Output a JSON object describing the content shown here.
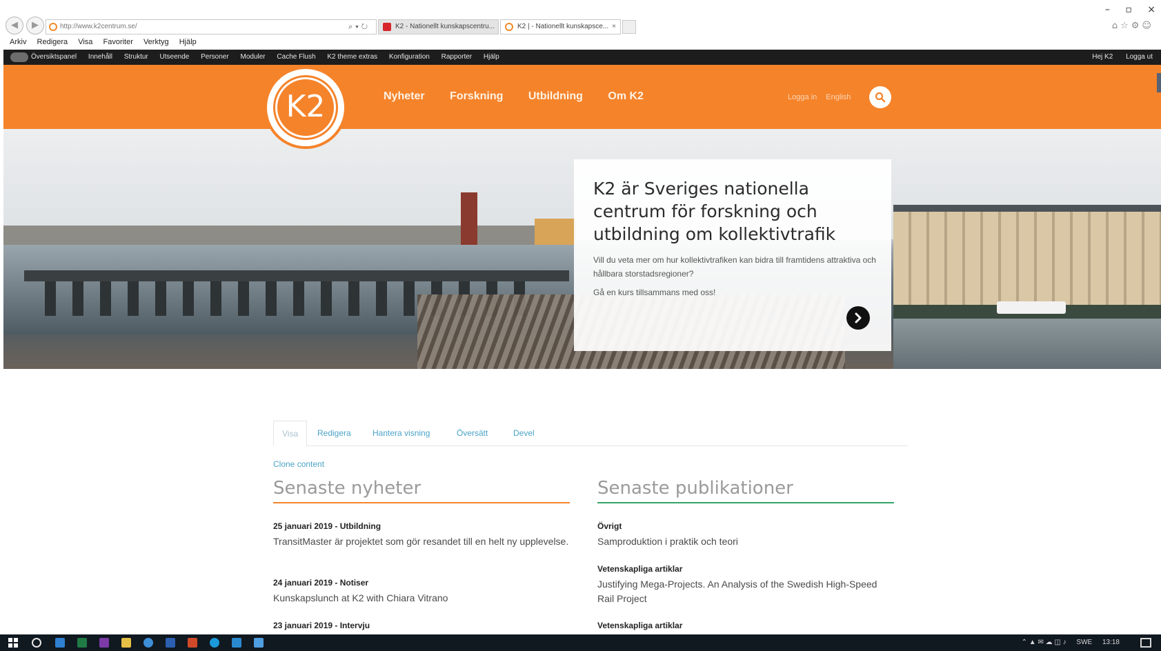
{
  "browser": {
    "address": "http://www.k2centrum.se/",
    "tabs": [
      {
        "label": "K2 - Nationellt kunskapscentru..."
      },
      {
        "label": "K2 | - Nationellt kunskapsce...",
        "close": "×"
      }
    ],
    "window_controls": "– ▫ ×",
    "menu": [
      "Arkiv",
      "Redigera",
      "Visa",
      "Favoriter",
      "Verktyg",
      "Hjälp"
    ]
  },
  "admin_toolbar": {
    "items": [
      "Översiktspanel",
      "Innehåll",
      "Struktur",
      "Utseende",
      "Personer",
      "Moduler",
      "Cache Flush",
      "K2 theme extras",
      "Konfiguration",
      "Rapporter",
      "Hjälp"
    ],
    "greeting": "Hej K2",
    "logout": "Logga ut"
  },
  "header": {
    "logo_text": "K2",
    "nav": [
      "Nyheter",
      "Forskning",
      "Utbildning",
      "Om K2"
    ],
    "login": "Logga in",
    "language": "English",
    "accent_color": "#f5832a"
  },
  "hero": {
    "title": "K2 är Sveriges nationella centrum för forskning och utbildning om kollektivtrafik",
    "text": "Vill du veta mer om hur kollektivtrafiken kan bidra till framtidens attraktiva och hållbara storstadsregioner?",
    "cta": "Gå en kurs tillsammans med oss!"
  },
  "local_tabs": [
    "Visa",
    "Redigera",
    "Hantera visning",
    "Översätt",
    "Devel"
  ],
  "clone_link": "Clone content",
  "news": {
    "heading": "Senaste nyheter",
    "items": [
      {
        "meta": "25 januari 2019 - Utbildning",
        "desc": "TransitMaster är projektet som gör resandet till en helt ny upplevelse."
      },
      {
        "meta": "24 januari 2019 - Notiser",
        "desc": "Kunskapslunch at K2 with Chiara Vitrano"
      },
      {
        "meta": "23 januari 2019 - Intervju",
        "desc": ""
      }
    ]
  },
  "publications": {
    "heading": "Senaste publikationer",
    "items": [
      {
        "meta": "Övrigt",
        "desc": "Samproduktion i praktik och teori"
      },
      {
        "meta": "Vetenskapliga artiklar",
        "desc": "Justifying Mega-Projects. An Analysis of the Swedish High-Speed Rail Project"
      },
      {
        "meta": "Vetenskapliga artiklar",
        "desc": ""
      }
    ]
  },
  "taskbar": {
    "language": "SWE",
    "time": "13:18"
  }
}
